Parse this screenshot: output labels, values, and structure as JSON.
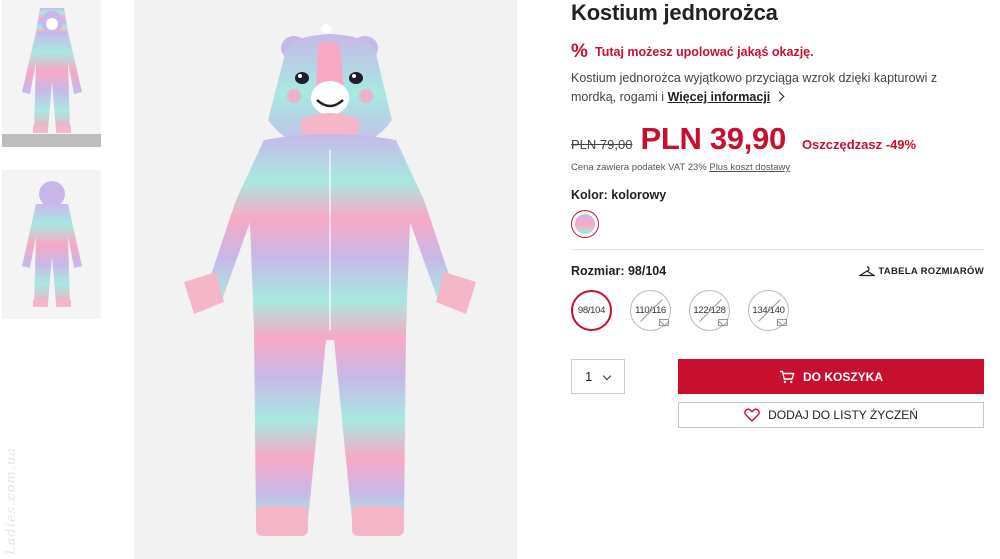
{
  "product": {
    "title": "Kostium jednorożca",
    "promo_icon": "%",
    "promo_text": "Tutaj możesz upolować jakąś okazję.",
    "description": "Kostium jednorożca wyjątkowo przyciąga wzrok dzięki kapturowi z mordką, rogami i ",
    "more_info": "Więcej informacji",
    "old_price": "PLN 79,00",
    "new_price": "PLN 39,90",
    "savings": "Oszczędzasz -49%",
    "vat_text": "Cena zawiera podatek VAT 23% ",
    "shipping_link": "Plus koszt dostawy",
    "color_label": "Kolor: kolorowy",
    "size_label": "Rozmiar: 98/104",
    "size_table_label": "TABELA ROZMIARÓW",
    "sizes": [
      {
        "label": "98/104",
        "available": true,
        "selected": true
      },
      {
        "label": "110/116",
        "available": false,
        "selected": false
      },
      {
        "label": "122/128",
        "available": false,
        "selected": false
      },
      {
        "label": "134/140",
        "available": false,
        "selected": false
      }
    ],
    "quantity": "1",
    "add_to_cart": "DO KOSZYKA",
    "add_to_wishlist": "DODAJ DO LISTY ŻYCZEŃ"
  },
  "watermark": "Ladies.com.ua",
  "colors": {
    "accent": "#c8102e",
    "pastel_pink": "#f7a9c4",
    "pastel_lilac": "#c8b8ea",
    "pastel_mint": "#a8e9e1",
    "cuff_pink": "#f5b6c8"
  },
  "icons": [
    "cart-icon",
    "heart-icon",
    "hanger-icon",
    "chevron-right-icon",
    "chevron-down-icon",
    "envelope-icon"
  ]
}
